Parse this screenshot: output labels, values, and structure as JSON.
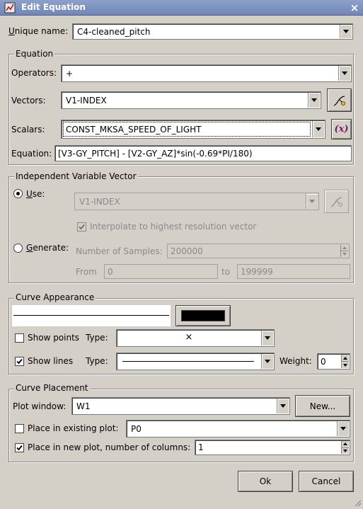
{
  "window": {
    "title": "Edit Equation",
    "close_label": "×"
  },
  "unique_name": {
    "label_pre": "U",
    "label_post": "nique name:",
    "value": "C4-cleaned_pitch"
  },
  "equation_group": {
    "legend": "Equation",
    "operators_label": "Operators:",
    "operators_value": "+",
    "vectors_label": "Vectors:",
    "vectors_value": "V1-INDEX",
    "scalars_label": "Scalars:",
    "scalars_value": "CONST_MKSA_SPEED_OF_LIGHT",
    "equation_label": "Equation:",
    "equation_value": "[V3-GY_PITCH] - [V2-GY_AZ]*sin(-0.69*PI/180)",
    "scalar_button_glyph": "(x)"
  },
  "independent": {
    "legend": "Independent Variable Vector",
    "use_pre": "U",
    "use_post": "se:",
    "use_vector": "V1-INDEX",
    "interpolate_label": "Interpolate to highest resolution vector",
    "generate_pre": "G",
    "generate_post": "enerate:",
    "samples_label": "Number of Samples:",
    "samples_value": "200000",
    "from_label": "From",
    "from_value": "0",
    "to_label": "to",
    "to_value": "199999"
  },
  "appearance": {
    "legend": "Curve Appearance",
    "show_points_label": "Show points",
    "points_type_label": "Type:",
    "points_type_value": "×",
    "show_lines_label": "Show lines",
    "lines_type_label": "Type:",
    "weight_label": "Weight:",
    "weight_value": "0",
    "color": "#000000"
  },
  "placement": {
    "legend": "Curve Placement",
    "plot_window_label": "Plot window:",
    "plot_window_value": "W1",
    "new_button": "New...",
    "existing_label": "Place in existing plot:",
    "existing_value": "P0",
    "new_plot_label": "Place in new plot, number of columns:",
    "columns_value": "1"
  },
  "footer": {
    "ok_label": "Ok",
    "cancel_label": "Cancel"
  }
}
